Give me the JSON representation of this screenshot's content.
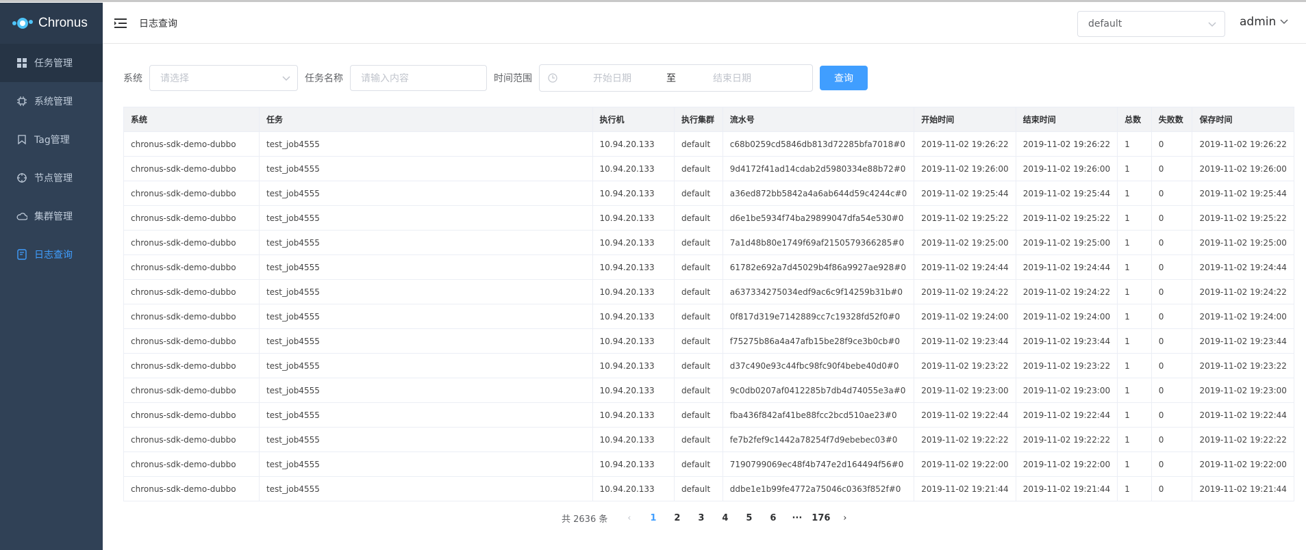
{
  "app": {
    "name": "Chronus"
  },
  "sidebar": {
    "items": [
      {
        "label": "任务管理",
        "icon": "grid-icon"
      },
      {
        "label": "系统管理",
        "icon": "chip-icon"
      },
      {
        "label": "Tag管理",
        "icon": "bookmark-icon"
      },
      {
        "label": "节点管理",
        "icon": "crosshair-icon"
      },
      {
        "label": "集群管理",
        "icon": "cloud-icon"
      },
      {
        "label": "日志查询",
        "icon": "log-icon"
      }
    ]
  },
  "header": {
    "breadcrumb": "日志查询",
    "namespace": "default",
    "user": "admin"
  },
  "filters": {
    "system_label": "系统",
    "system_placeholder": "请选择",
    "task_label": "任务名称",
    "task_placeholder": "请输入内容",
    "range_label": "时间范围",
    "start_placeholder": "开始日期",
    "range_sep": "至",
    "end_placeholder": "结束日期",
    "query_button": "查询"
  },
  "table": {
    "columns": [
      "系统",
      "任务",
      "执行机",
      "执行集群",
      "流水号",
      "开始时间",
      "结束时间",
      "总数",
      "失败数",
      "保存时间"
    ],
    "rows": [
      [
        "chronus-sdk-demo-dubbo",
        "test_job4555",
        "10.94.20.133",
        "default",
        "c68b0259cd5846db813d72285bfa7018#0",
        "2019-11-02 19:26:22",
        "2019-11-02 19:26:22",
        "1",
        "0",
        "2019-11-02 19:26:22"
      ],
      [
        "chronus-sdk-demo-dubbo",
        "test_job4555",
        "10.94.20.133",
        "default",
        "9d4172f41ad14cdab2d5980334e88b72#0",
        "2019-11-02 19:26:00",
        "2019-11-02 19:26:00",
        "1",
        "0",
        "2019-11-02 19:26:00"
      ],
      [
        "chronus-sdk-demo-dubbo",
        "test_job4555",
        "10.94.20.133",
        "default",
        "a36ed872bb5842a4a6ab644d59c4244c#0",
        "2019-11-02 19:25:44",
        "2019-11-02 19:25:44",
        "1",
        "0",
        "2019-11-02 19:25:44"
      ],
      [
        "chronus-sdk-demo-dubbo",
        "test_job4555",
        "10.94.20.133",
        "default",
        "d6e1be5934f74ba29899047dfa54e530#0",
        "2019-11-02 19:25:22",
        "2019-11-02 19:25:22",
        "1",
        "0",
        "2019-11-02 19:25:22"
      ],
      [
        "chronus-sdk-demo-dubbo",
        "test_job4555",
        "10.94.20.133",
        "default",
        "7a1d48b80e1749f69af2150579366285#0",
        "2019-11-02 19:25:00",
        "2019-11-02 19:25:00",
        "1",
        "0",
        "2019-11-02 19:25:00"
      ],
      [
        "chronus-sdk-demo-dubbo",
        "test_job4555",
        "10.94.20.133",
        "default",
        "61782e692a7d45029b4f86a9927ae928#0",
        "2019-11-02 19:24:44",
        "2019-11-02 19:24:44",
        "1",
        "0",
        "2019-11-02 19:24:44"
      ],
      [
        "chronus-sdk-demo-dubbo",
        "test_job4555",
        "10.94.20.133",
        "default",
        "a637334275034edf9ac6c9f14259b31b#0",
        "2019-11-02 19:24:22",
        "2019-11-02 19:24:22",
        "1",
        "0",
        "2019-11-02 19:24:22"
      ],
      [
        "chronus-sdk-demo-dubbo",
        "test_job4555",
        "10.94.20.133",
        "default",
        "0f817d319e7142889cc7c19328fd52f0#0",
        "2019-11-02 19:24:00",
        "2019-11-02 19:24:00",
        "1",
        "0",
        "2019-11-02 19:24:00"
      ],
      [
        "chronus-sdk-demo-dubbo",
        "test_job4555",
        "10.94.20.133",
        "default",
        "f75275b86a4a47afb15be28f9ce3b0cb#0",
        "2019-11-02 19:23:44",
        "2019-11-02 19:23:44",
        "1",
        "0",
        "2019-11-02 19:23:44"
      ],
      [
        "chronus-sdk-demo-dubbo",
        "test_job4555",
        "10.94.20.133",
        "default",
        "d37c490e93c44fbc98fc90f4bebe40d0#0",
        "2019-11-02 19:23:22",
        "2019-11-02 19:23:22",
        "1",
        "0",
        "2019-11-02 19:23:22"
      ],
      [
        "chronus-sdk-demo-dubbo",
        "test_job4555",
        "10.94.20.133",
        "default",
        "9c0db0207af0412285b7db4d74055e3a#0",
        "2019-11-02 19:23:00",
        "2019-11-02 19:23:00",
        "1",
        "0",
        "2019-11-02 19:23:00"
      ],
      [
        "chronus-sdk-demo-dubbo",
        "test_job4555",
        "10.94.20.133",
        "default",
        "fba436f842af41be88fcc2bcd510ae23#0",
        "2019-11-02 19:22:44",
        "2019-11-02 19:22:44",
        "1",
        "0",
        "2019-11-02 19:22:44"
      ],
      [
        "chronus-sdk-demo-dubbo",
        "test_job4555",
        "10.94.20.133",
        "default",
        "fe7b2fef9c1442a78254f7d9ebebec03#0",
        "2019-11-02 19:22:22",
        "2019-11-02 19:22:22",
        "1",
        "0",
        "2019-11-02 19:22:22"
      ],
      [
        "chronus-sdk-demo-dubbo",
        "test_job4555",
        "10.94.20.133",
        "default",
        "7190799069ec48f4b747e2d164494f56#0",
        "2019-11-02 19:22:00",
        "2019-11-02 19:22:00",
        "1",
        "0",
        "2019-11-02 19:22:00"
      ],
      [
        "chronus-sdk-demo-dubbo",
        "test_job4555",
        "10.94.20.133",
        "default",
        "ddbe1e1b99fe4772a75046c0363f852f#0",
        "2019-11-02 19:21:44",
        "2019-11-02 19:21:44",
        "1",
        "0",
        "2019-11-02 19:21:44"
      ]
    ]
  },
  "pagination": {
    "total": "共 2636 条",
    "pages": [
      "1",
      "2",
      "3",
      "4",
      "5",
      "6",
      "···",
      "176"
    ],
    "current": "1"
  }
}
